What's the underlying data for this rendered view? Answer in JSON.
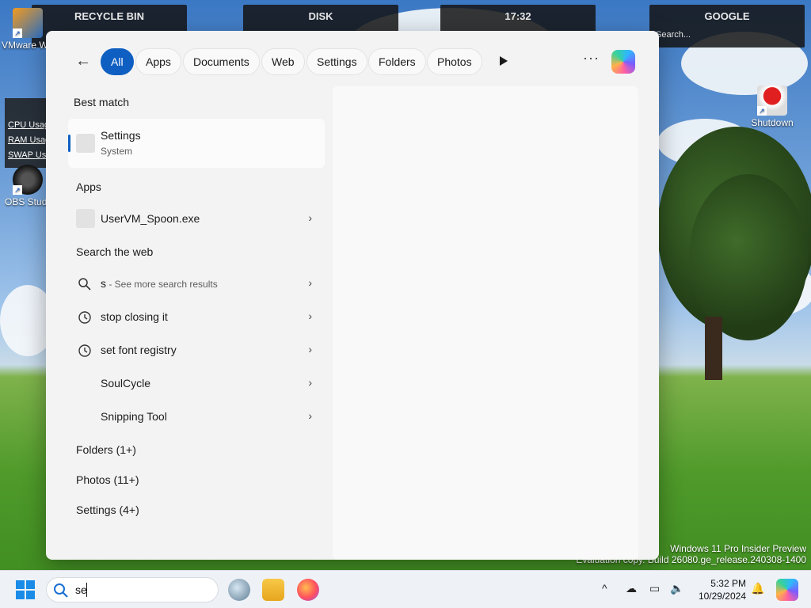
{
  "desktop": {
    "widgets": [
      {
        "title": "RECYCLE BIN",
        "sub": ""
      },
      {
        "title": "DISK",
        "sub": ""
      },
      {
        "title": "17:32",
        "sub": ""
      },
      {
        "title": "GOOGLE",
        "sub": "Search..."
      }
    ],
    "icons": [
      {
        "label": "VMware Workstation"
      },
      {
        "label": "OBS Studio"
      },
      {
        "label": "Shutdown"
      }
    ],
    "sysmon": [
      "CPU Usage",
      "RAM Usage",
      "SWAP Usage"
    ],
    "vmware_badge": "0",
    "watermark_line1": "Windows 11 Pro Insider Preview",
    "watermark_line2": "Evaluation copy. Build 26080.ge_release.240308-1400"
  },
  "panel": {
    "filters": [
      "All",
      "Apps",
      "Documents",
      "Web",
      "Settings",
      "Folders",
      "Photos"
    ],
    "active_filter": "All",
    "more": "···",
    "best_match": {
      "heading": "Best match",
      "title": "Settings",
      "subtitle": "System"
    },
    "apps": {
      "heading": "Apps",
      "items": [
        {
          "label": "UserVM_Spoon.exe"
        }
      ]
    },
    "web": {
      "heading": "Search the web",
      "items": [
        {
          "label": "s",
          "hint": " - See more search results",
          "icon": "search-icon"
        },
        {
          "label": "stop closing it",
          "hint": "",
          "icon": "history-icon"
        },
        {
          "label": "set font registry",
          "hint": "",
          "icon": "history-icon"
        },
        {
          "label": "SoulCycle",
          "hint": "",
          "icon": "none"
        },
        {
          "label": "Snipping Tool",
          "hint": "",
          "icon": "none"
        }
      ]
    },
    "groups": [
      {
        "label": "Folders (1+)"
      },
      {
        "label": "Photos (11+)"
      },
      {
        "label": "Settings (4+)"
      }
    ]
  },
  "taskbar": {
    "search_query": "se",
    "clock_time": "5:32 PM",
    "clock_date": "10/29/2024",
    "tray_chevron": "^"
  },
  "colors": {
    "accent": "#0f5fc2",
    "panel_bg": "#f3f3f3",
    "taskbar_bg": "#eef2f7"
  }
}
